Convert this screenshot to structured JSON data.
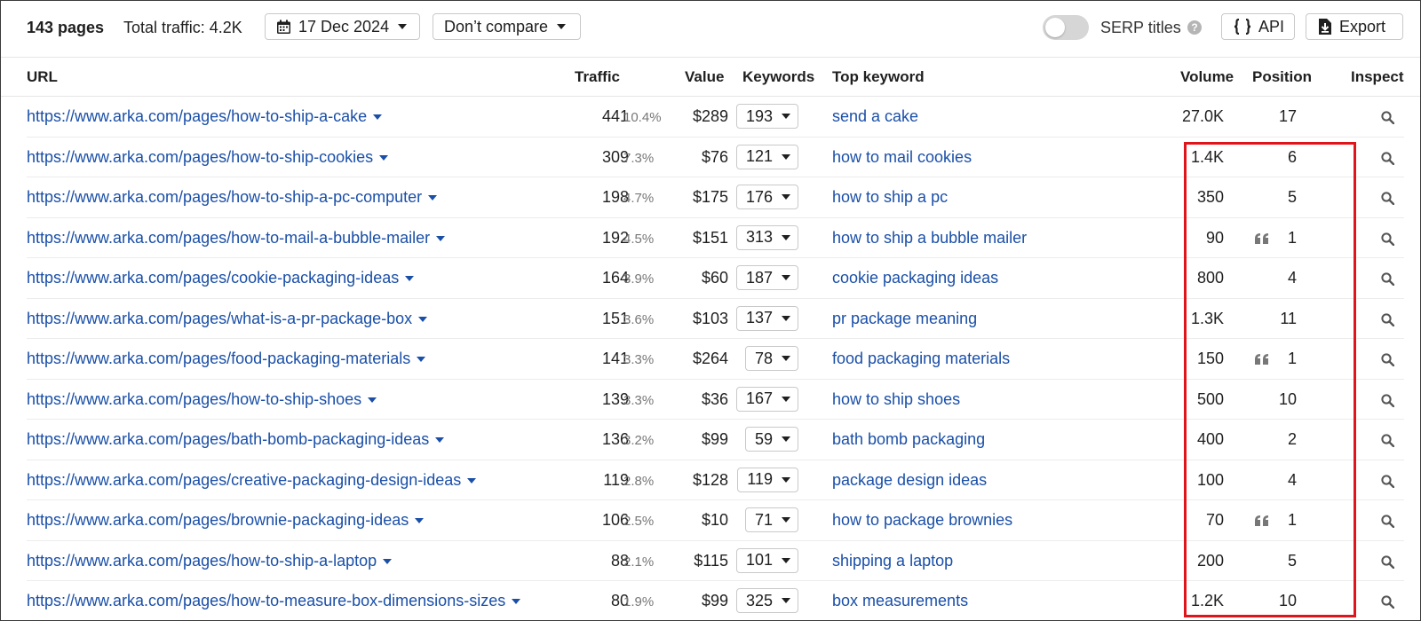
{
  "toolbar": {
    "pages_count": "143 pages",
    "total_traffic": "Total traffic: 4.2K",
    "date": "17 Dec 2024",
    "compare": "Don’t compare",
    "serp_titles": "SERP titles",
    "help": "?",
    "api": "API",
    "export": "Export"
  },
  "columns": {
    "url": "URL",
    "traffic": "Traffic",
    "value": "Value",
    "keywords": "Keywords",
    "top_keyword": "Top keyword",
    "volume": "Volume",
    "position": "Position",
    "inspect": "Inspect"
  },
  "rows": [
    {
      "url": "https://www.arka.com/pages/how-to-ship-a-cake",
      "traffic": "441",
      "pct": "10.4%",
      "value": "$289",
      "keywords": "193",
      "top_keyword": "send a cake",
      "volume": "27.0K",
      "quote": false,
      "position": "17"
    },
    {
      "url": "https://www.arka.com/pages/how-to-ship-cookies",
      "traffic": "309",
      "pct": "7.3%",
      "value": "$76",
      "keywords": "121",
      "top_keyword": "how to mail cookies",
      "volume": "1.4K",
      "quote": false,
      "position": "6"
    },
    {
      "url": "https://www.arka.com/pages/how-to-ship-a-pc-computer",
      "traffic": "198",
      "pct": "4.7%",
      "value": "$175",
      "keywords": "176",
      "top_keyword": "how to ship a pc",
      "volume": "350",
      "quote": false,
      "position": "5"
    },
    {
      "url": "https://www.arka.com/pages/how-to-mail-a-bubble-mailer",
      "traffic": "192",
      "pct": "4.5%",
      "value": "$151",
      "keywords": "313",
      "top_keyword": "how to ship a bubble mailer",
      "volume": "90",
      "quote": true,
      "position": "1"
    },
    {
      "url": "https://www.arka.com/pages/cookie-packaging-ideas",
      "traffic": "164",
      "pct": "3.9%",
      "value": "$60",
      "keywords": "187",
      "top_keyword": "cookie packaging ideas",
      "volume": "800",
      "quote": false,
      "position": "4"
    },
    {
      "url": "https://www.arka.com/pages/what-is-a-pr-package-box",
      "traffic": "151",
      "pct": "3.6%",
      "value": "$103",
      "keywords": "137",
      "top_keyword": "pr package meaning",
      "volume": "1.3K",
      "quote": false,
      "position": "11"
    },
    {
      "url": "https://www.arka.com/pages/food-packaging-materials",
      "traffic": "141",
      "pct": "3.3%",
      "value": "$264",
      "keywords": "78",
      "top_keyword": "food packaging materials",
      "volume": "150",
      "quote": true,
      "position": "1"
    },
    {
      "url": "https://www.arka.com/pages/how-to-ship-shoes",
      "traffic": "139",
      "pct": "3.3%",
      "value": "$36",
      "keywords": "167",
      "top_keyword": "how to ship shoes",
      "volume": "500",
      "quote": false,
      "position": "10"
    },
    {
      "url": "https://www.arka.com/pages/bath-bomb-packaging-ideas",
      "traffic": "136",
      "pct": "3.2%",
      "value": "$99",
      "keywords": "59",
      "top_keyword": "bath bomb packaging",
      "volume": "400",
      "quote": false,
      "position": "2"
    },
    {
      "url": "https://www.arka.com/pages/creative-packaging-design-ideas",
      "traffic": "119",
      "pct": "2.8%",
      "value": "$128",
      "keywords": "119",
      "top_keyword": "package design ideas",
      "volume": "100",
      "quote": false,
      "position": "4"
    },
    {
      "url": "https://www.arka.com/pages/brownie-packaging-ideas",
      "traffic": "106",
      "pct": "2.5%",
      "value": "$10",
      "keywords": "71",
      "top_keyword": "how to package brownies",
      "volume": "70",
      "quote": true,
      "position": "1"
    },
    {
      "url": "https://www.arka.com/pages/how-to-ship-a-laptop",
      "traffic": "88",
      "pct": "2.1%",
      "value": "$115",
      "keywords": "101",
      "top_keyword": "shipping a laptop",
      "volume": "200",
      "quote": false,
      "position": "5"
    },
    {
      "url": "https://www.arka.com/pages/how-to-measure-box-dimensions-sizes",
      "traffic": "80",
      "pct": "1.9%",
      "value": "$99",
      "keywords": "325",
      "top_keyword": "box measurements",
      "volume": "1.2K",
      "quote": false,
      "position": "10"
    }
  ],
  "icons": {
    "calendar": "calendar-icon",
    "braces": "braces-icon",
    "download": "download-icon",
    "search": "search-icon",
    "quote": "quote-icon"
  },
  "colors": {
    "link": "#1a4fa8",
    "highlight": "#e0151b",
    "toggle_off": "#d6d6d6"
  }
}
